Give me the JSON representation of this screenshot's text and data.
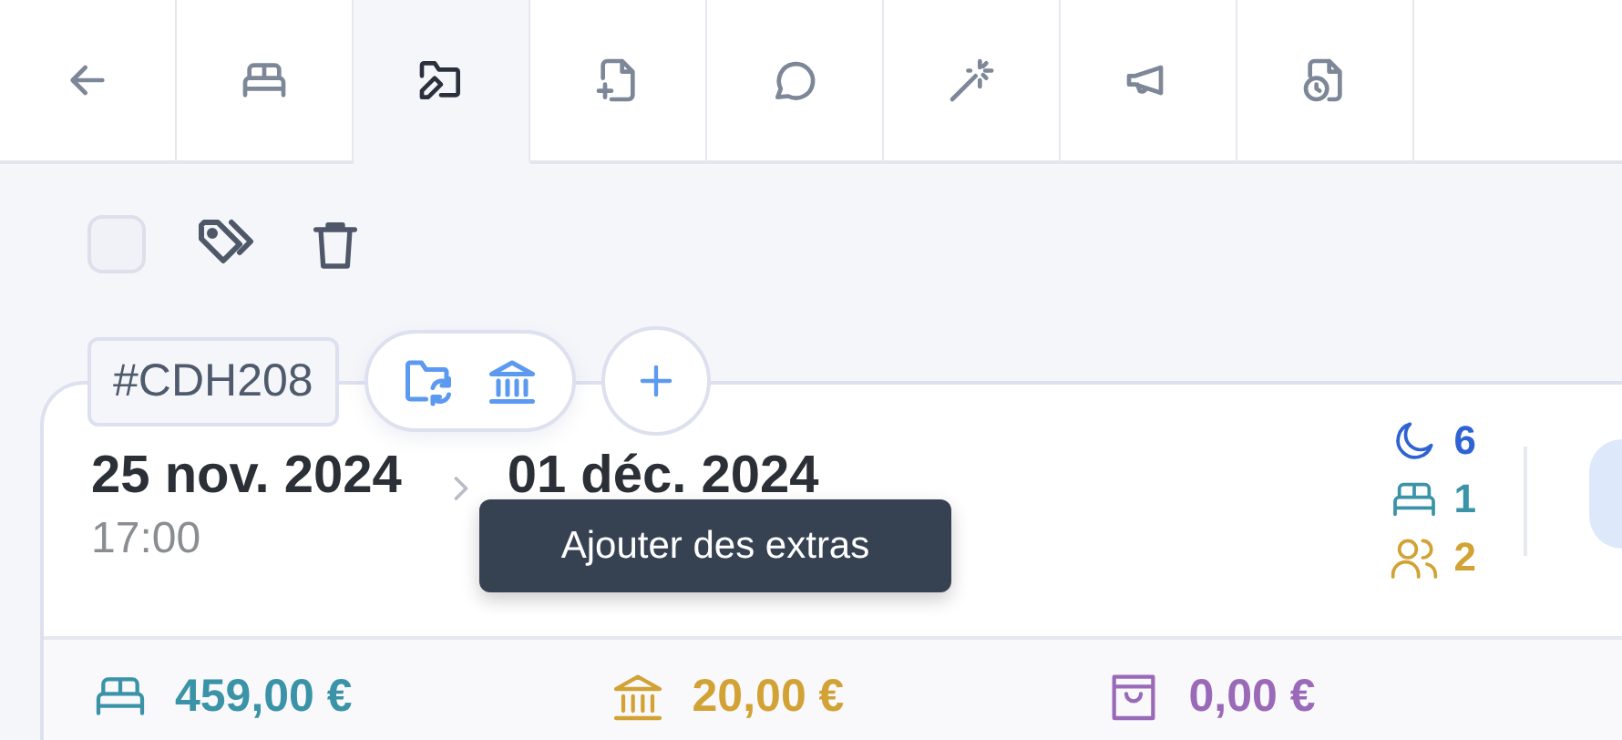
{
  "tabs": [
    {
      "selected": false
    },
    {
      "selected": true
    },
    {
      "selected": false
    },
    {
      "selected": false
    },
    {
      "selected": false
    },
    {
      "selected": false
    },
    {
      "selected": false
    }
  ],
  "toolbar": {
    "select_all": {
      "checked": false
    }
  },
  "booking": {
    "reference": "#CDH208",
    "tooltip": "Ajouter des extras",
    "arrival": {
      "date": "25 nov. 2024",
      "time": "17:00"
    },
    "departure": {
      "date": "01 déc. 2024"
    },
    "stats": [
      {
        "value": "6",
        "color": "#2f63d4"
      },
      {
        "value": "1",
        "color": "#3a93a6"
      },
      {
        "value": "2",
        "color": "#d2a235"
      }
    ],
    "totals": [
      {
        "amount": "459,00 €",
        "color": "#3a93a6"
      },
      {
        "amount": "20,00 €",
        "color": "#d2a235"
      },
      {
        "amount": "0,00 €",
        "color": "#9a6ab8"
      }
    ]
  }
}
